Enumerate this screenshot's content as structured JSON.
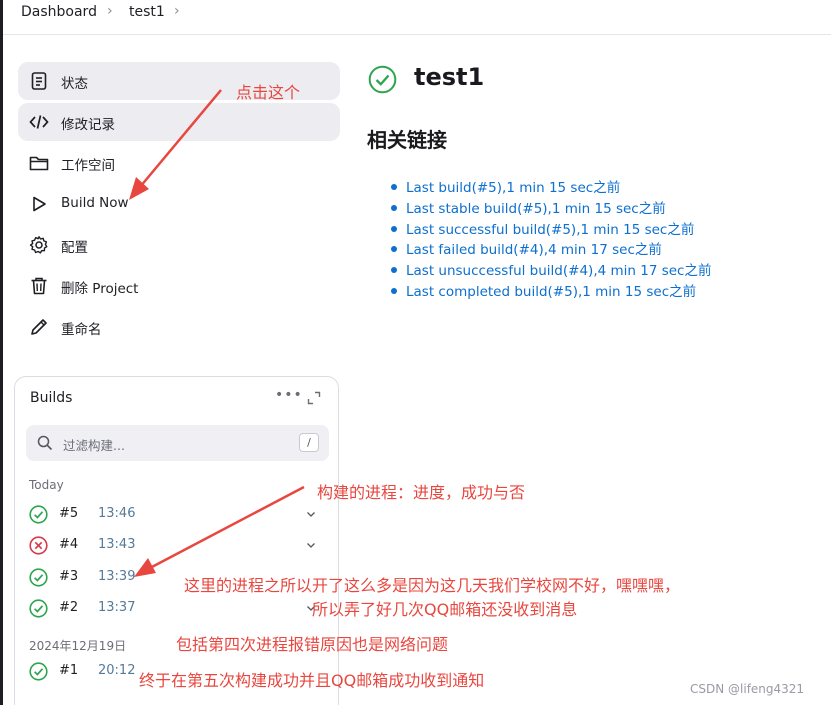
{
  "breadcrumb": {
    "items": [
      "Dashboard",
      "test1"
    ]
  },
  "sidebar": {
    "items": [
      {
        "label": "状态",
        "icon": "status-document-icon",
        "active": true
      },
      {
        "label": "修改记录",
        "icon": "code-icon",
        "active": true
      },
      {
        "label": "工作空间",
        "icon": "folder-icon",
        "active": false
      },
      {
        "label": "Build Now",
        "icon": "play-icon",
        "active": false
      },
      {
        "label": "配置",
        "icon": "gear-icon",
        "active": false
      },
      {
        "label": "删除 Project",
        "icon": "trash-icon",
        "active": false
      },
      {
        "label": "重命名",
        "icon": "pencil-icon",
        "active": false
      }
    ]
  },
  "builds": {
    "title": "Builds",
    "more_icon": "more-horizontal-icon",
    "expand_icon": "expand-icon",
    "filter": {
      "placeholder": "过滤构建...",
      "shortcut": "/"
    },
    "groups": [
      {
        "label": "Today",
        "rows": [
          {
            "number": "#5",
            "time": "13:46",
            "status": "success",
            "chevron": true
          },
          {
            "number": "#4",
            "time": "13:43",
            "status": "failed",
            "chevron": true
          },
          {
            "number": "#3",
            "time": "13:39",
            "status": "success",
            "chevron": false
          },
          {
            "number": "#2",
            "time": "13:37",
            "status": "success",
            "chevron": true
          }
        ]
      },
      {
        "label": "2024年12月19日",
        "rows": [
          {
            "number": "#1",
            "time": "20:12",
            "status": "success",
            "chevron": false
          }
        ]
      }
    ]
  },
  "main": {
    "title": "test1",
    "status": "success",
    "links_heading": "相关链接",
    "links": [
      "Last build(#5),1 min 15 sec之前",
      "Last stable build(#5),1 min 15 sec之前",
      "Last successful build(#5),1 min 15 sec之前",
      "Last failed build(#4),4 min 17 sec之前",
      "Last unsuccessful build(#4),4 min 17 sec之前",
      "Last completed build(#5),1 min 15 sec之前"
    ]
  },
  "annotations": {
    "click_this": "点击这个",
    "build_progress": "构建的进程：进度，成功与否",
    "note_line1": "这里的进程之所以开了这么多是因为这几天我们学校网不好，嘿嘿嘿，",
    "note_line2": "所以弄了好几次QQ邮箱还没收到消息",
    "note_line3": "包括第四次进程报错原因也是网络问题",
    "note_line4": "终于在第五次构建成功并且QQ邮箱成功收到通知"
  },
  "watermark": "CSDN @lifeng4321",
  "colors": {
    "success": "#2ea44f",
    "failed": "#d73a49",
    "link": "#0d6fcf",
    "annotation": "#e8473f",
    "active_item_bg": "#ececf1"
  }
}
